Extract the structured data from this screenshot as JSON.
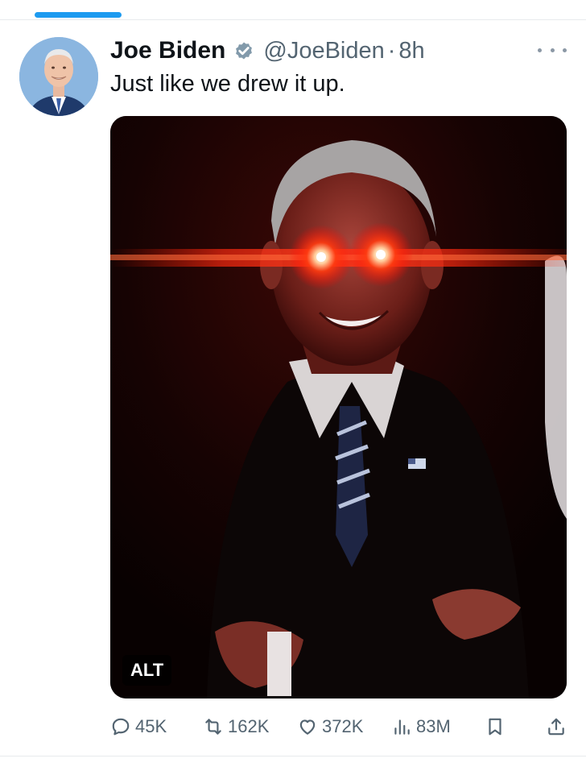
{
  "author": {
    "display_name": "Joe Biden",
    "handle": "@JoeBiden",
    "separator": "·",
    "timestamp": "8h",
    "verified_icon": "verified-badge-icon",
    "avatar_icon": "profile-photo"
  },
  "tweet": {
    "text": "Just like we drew it up.",
    "media_alt_label": "ALT"
  },
  "actions": {
    "replies": "45K",
    "reposts": "162K",
    "likes": "372K",
    "views": "83M"
  },
  "colors": {
    "accent": "#1d9bf0",
    "text_primary": "#0f1419",
    "text_secondary": "#536471",
    "divider": "#e7eaed",
    "laser_red": "#ff2a10"
  }
}
